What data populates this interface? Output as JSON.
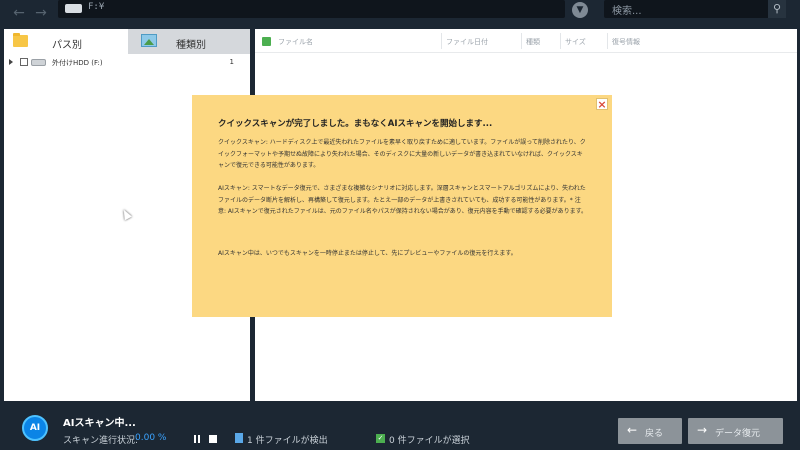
{
  "topbar": {
    "back_icon": "arrow-left-icon",
    "forward_icon": "arrow-right-icon",
    "path": "F:¥",
    "search_placeholder": "検索..."
  },
  "left_panel": {
    "tabs": [
      {
        "label": "パス別",
        "icon": "folder-icon"
      },
      {
        "label": "種類別",
        "icon": "image-icon"
      }
    ],
    "tree": [
      {
        "label": "外付けHDD (F:)",
        "count": "1"
      }
    ]
  },
  "file_list": {
    "columns": [
      "ファイル名",
      "ファイル日付",
      "種類",
      "サイズ",
      "復号情報"
    ]
  },
  "dialog": {
    "title": "クイックスキャンが完了しました。まもなくAIスキャンを開始します...",
    "paragraphs": [
      "クイックスキャン: ハードディスク上で最近失われたファイルを素早く取り戻すために適しています。ファイルが誤って削除されたり、クイックフォーマットや予期せぬ故障により失われた場合、そのディスクに大量の新しいデータが書き込まれていなければ、クイックスキャンで復元できる可能性があります。",
      "AIスキャン: スマートなデータ復元で、さまざまな複雑なシナリオに対応します。深層スキャンとスマートアルゴリズムにより、失われたファイルのデータ断片を解析し、再構築して復元します。たとえ一部のデータが上書きされていても、成功する可能性があります。* 注意: AIスキャンで復元されたファイルは、元のファイル名やパスが保持されない場合があり、復元内容を手動で確認する必要があります。",
      "AIスキャン中は、いつでもスキャンを一時停止または停止して、先にプレビューやファイルの復元を行えます。"
    ],
    "close_icon": "close-icon"
  },
  "statusbar": {
    "logo_text": "AI",
    "scan_title": "AIスキャン中...",
    "progress_label": "スキャン進行状況:",
    "progress_value": "0.00 %",
    "found_text": "1 件ファイルが検出",
    "selected_text": "0 件ファイルが選択",
    "back_label": "戻る",
    "recover_label": "データ復元"
  },
  "colors": {
    "background": "#1c2733",
    "dialog": "#fcd882",
    "accent": "#3aa3ff",
    "check_green": "#4caf50"
  }
}
